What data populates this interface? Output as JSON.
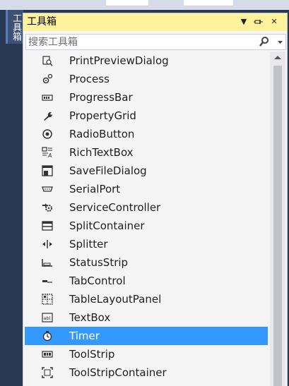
{
  "side_tab": {
    "label": "工具箱"
  },
  "toolbox": {
    "title": "工具箱",
    "pin_glyph": "⊣",
    "close_glyph": "✕",
    "menu_glyph": "▼",
    "search": {
      "placeholder": "搜索工具箱",
      "value": ""
    },
    "items": [
      {
        "label": "PrintPreviewDialog",
        "icon": "print-preview-icon",
        "selected": false
      },
      {
        "label": "Process",
        "icon": "process-icon",
        "selected": false
      },
      {
        "label": "ProgressBar",
        "icon": "progressbar-icon",
        "selected": false
      },
      {
        "label": "PropertyGrid",
        "icon": "wrench-icon",
        "selected": false
      },
      {
        "label": "RadioButton",
        "icon": "radio-button-icon",
        "selected": false
      },
      {
        "label": "RichTextBox",
        "icon": "rich-textbox-icon",
        "selected": false
      },
      {
        "label": "SaveFileDialog",
        "icon": "save-dialog-icon",
        "selected": false
      },
      {
        "label": "SerialPort",
        "icon": "serial-port-icon",
        "selected": false
      },
      {
        "label": "ServiceController",
        "icon": "service-controller-icon",
        "selected": false
      },
      {
        "label": "SplitContainer",
        "icon": "split-container-icon",
        "selected": false
      },
      {
        "label": "Splitter",
        "icon": "splitter-icon",
        "selected": false
      },
      {
        "label": "StatusStrip",
        "icon": "status-strip-icon",
        "selected": false
      },
      {
        "label": "TabControl",
        "icon": "tab-control-icon",
        "selected": false
      },
      {
        "label": "TableLayoutPanel",
        "icon": "table-layout-icon",
        "selected": false
      },
      {
        "label": "TextBox",
        "icon": "textbox-icon",
        "selected": false
      },
      {
        "label": "Timer",
        "icon": "timer-icon",
        "selected": true
      },
      {
        "label": "ToolStrip",
        "icon": "toolstrip-icon",
        "selected": false
      },
      {
        "label": "ToolStripContainer",
        "icon": "toolstrip-container-icon",
        "selected": false
      }
    ]
  },
  "colors": {
    "title_bar": "#fff29d",
    "selection": "#3399ff",
    "background": "#293955",
    "panel": "#f5f5f5"
  }
}
